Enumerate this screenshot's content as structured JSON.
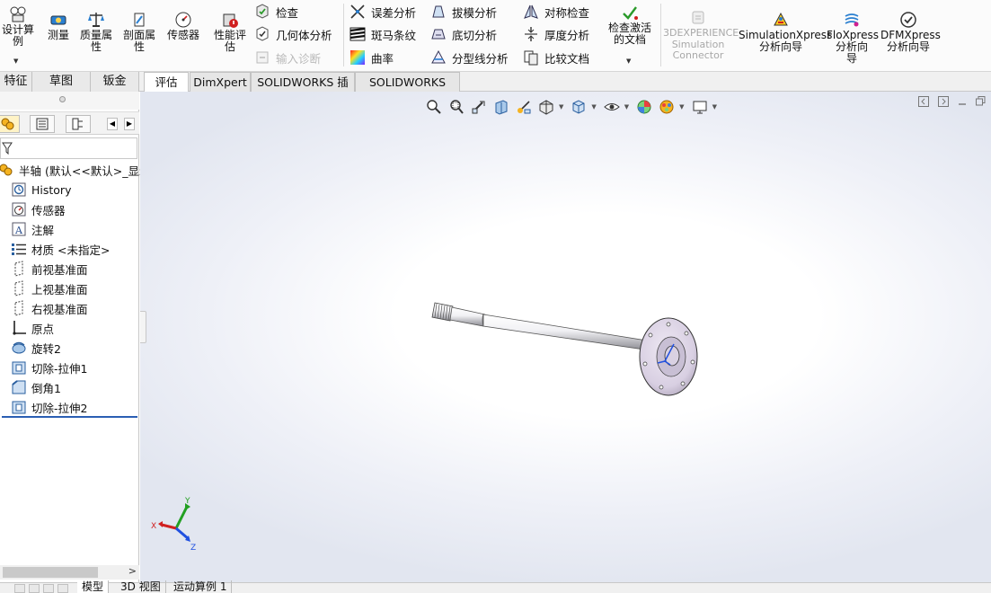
{
  "ribbon": {
    "design_study_label": "设计算\n例",
    "measure_label": "测量",
    "mass_props_label": "质量属\n性",
    "section_props_label": "剖面属\n性",
    "sensor_label": "传感器",
    "perf_eval_label": "性能评\n估",
    "check_label": "检查",
    "geometry_analysis_label": "几何体分析",
    "import_diagnostics_label": "输入诊断",
    "deviation_label": "误差分析",
    "zebra_label": "斑马条纹",
    "curvature_label": "曲率",
    "draft_label": "拔模分析",
    "undercut_label": "底切分析",
    "parting_line_label": "分型线分析",
    "symmetry_label": "对称检查",
    "thickness_label": "厚度分析",
    "compare_label": "比较文档",
    "check_active_doc_label": "检查激活\n的文档",
    "threedx_label": "3DEXPERIENCE\nSimulation\nConnector",
    "simxpress_label": "SimulationXpress\n分析向导",
    "floxpress_label": "FloXpress\n分析向\n导",
    "dfmxpress_label": "DFMXpress\n分析向导"
  },
  "panel_tabs": [
    "特征",
    "草图",
    "钣金"
  ],
  "cmd_tabs": [
    "评估",
    "DimXpert",
    "SOLIDWORKS 插件",
    "SOLIDWORKS MBD"
  ],
  "tree": {
    "root_label": "半轴 (默认<<默认>_显示",
    "items": [
      {
        "label": "History",
        "icon": "history-icon"
      },
      {
        "label": "传感器",
        "icon": "sensor-folder-icon"
      },
      {
        "label": "注解",
        "icon": "annotation-icon"
      },
      {
        "label": "材质 <未指定>",
        "icon": "material-icon"
      },
      {
        "label": "前视基准面",
        "icon": "plane-icon"
      },
      {
        "label": "上视基准面",
        "icon": "plane-icon"
      },
      {
        "label": "右视基准面",
        "icon": "plane-icon"
      },
      {
        "label": "原点",
        "icon": "origin-icon"
      },
      {
        "label": "旋转2",
        "icon": "revolve-icon"
      },
      {
        "label": "切除-拉伸1",
        "icon": "cut-extrude-icon"
      },
      {
        "label": "倒角1",
        "icon": "chamfer-icon"
      },
      {
        "label": "切除-拉伸2",
        "icon": "cut-extrude-icon"
      }
    ]
  },
  "triad": {
    "x": "X",
    "y": "Y",
    "z": "Z"
  },
  "bottom_tabs": [
    "模型",
    "3D 视图",
    "运动算例 1"
  ],
  "colors": {
    "accent": "#2b5fb3",
    "rollback_bar": "#2b5fb3",
    "flange": "#d8cfe2",
    "shaft": "#e8e8ee"
  }
}
